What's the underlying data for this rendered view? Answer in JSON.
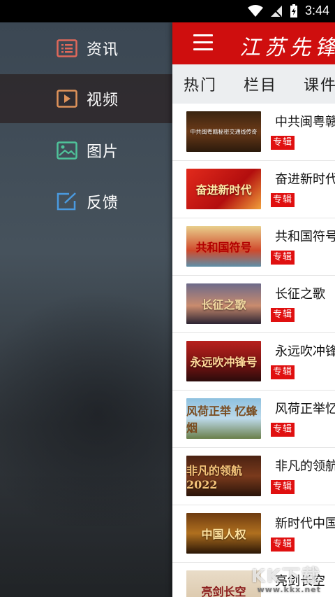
{
  "status_bar": {
    "time": "3:44"
  },
  "drawer": {
    "items": [
      {
        "label": "资讯",
        "icon": "news-list-icon",
        "color": "#e0685a",
        "active": false
      },
      {
        "label": "视频",
        "icon": "video-play-icon",
        "color": "#e0935a",
        "active": true
      },
      {
        "label": "图片",
        "icon": "image-icon",
        "color": "#4fc39a",
        "active": false
      },
      {
        "label": "反馈",
        "icon": "feedback-edit-icon",
        "color": "#4a9ae0",
        "active": false
      }
    ]
  },
  "header": {
    "logo": "江苏先锋",
    "accent": "#cf0e0e"
  },
  "tabs": [
    "热门",
    "栏目",
    "课件"
  ],
  "list": {
    "badge": "专辑",
    "items": [
      {
        "title": "中共闽粤赣",
        "thumb_text": "中共闽粤赣秘密交通线传奇"
      },
      {
        "title": "奋进新时代",
        "thumb_text": "奋进新时代"
      },
      {
        "title": "共和国符号",
        "thumb_text": "共和国符号"
      },
      {
        "title": "长征之歌",
        "thumb_text": "长征之歌"
      },
      {
        "title": "永远吹冲锋",
        "thumb_text": "永远吹冲锋号"
      },
      {
        "title": "风荷正举忆",
        "thumb_text": "风荷正举 忆蜂烟"
      },
      {
        "title": "非凡的领航",
        "thumb_text": "非凡的领航 2022"
      },
      {
        "title": "新时代中国",
        "thumb_text": "中国人权"
      },
      {
        "title": "亮剑长空",
        "thumb_text": "亮剑长空"
      }
    ]
  },
  "watermark": {
    "text": "KK下载",
    "sub": "www.kkx.net"
  }
}
